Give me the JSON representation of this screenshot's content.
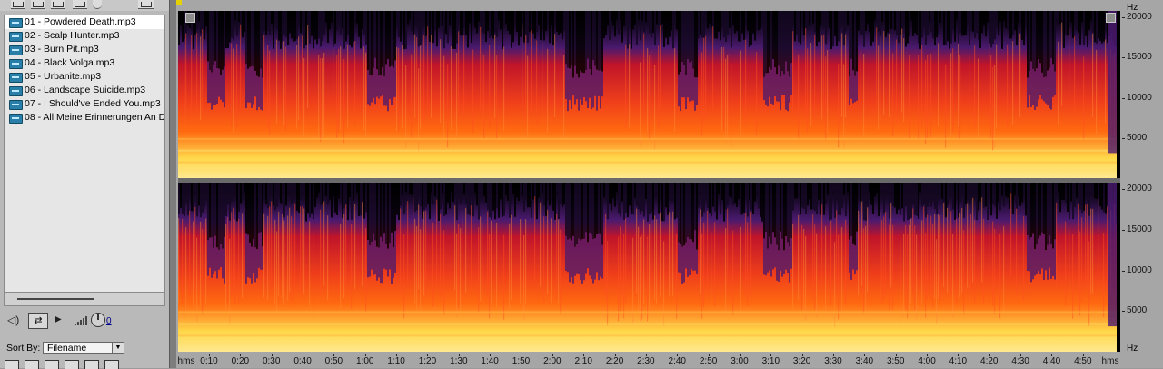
{
  "file_panel": {
    "files": [
      {
        "label": "01 - Powdered Death.mp3",
        "selected": true
      },
      {
        "label": "02 - Scalp Hunter.mp3",
        "selected": false
      },
      {
        "label": "03 - Burn Pit.mp3",
        "selected": false
      },
      {
        "label": "04 - Black Volga.mp3",
        "selected": false
      },
      {
        "label": "05 - Urbanite.mp3",
        "selected": false
      },
      {
        "label": "06 - Landscape Suicide.mp3",
        "selected": false
      },
      {
        "label": "07 - I Should've Ended You.mp3",
        "selected": false
      },
      {
        "label": "08 - All Meine Erinnerungen An D",
        "selected": false
      }
    ],
    "file_icon": "audio-file-icon",
    "toolbar_icons": [
      "open-file-icon",
      "close-file-icon",
      "import-icon",
      "properties-icon",
      "disc-icon",
      "new-window-icon"
    ],
    "transport": {
      "icons": [
        "speaker-icon",
        "loop-icon",
        "play-icon",
        "volume-bars-icon",
        "volume-knob-icon"
      ],
      "volume_value": "0"
    },
    "sort": {
      "label": "Sort By:",
      "value": "Filename"
    }
  },
  "spectral_view": {
    "frequency_axis": {
      "unit": "Hz",
      "labels": [
        "20000",
        "15000",
        "10000",
        "5000"
      ]
    },
    "time_axis": {
      "unit": "hms",
      "labels": [
        "0:10",
        "0:20",
        "0:30",
        "0:40",
        "0:50",
        "1:00",
        "1:10",
        "1:20",
        "1:30",
        "1:40",
        "1:50",
        "2:00",
        "2:10",
        "2:20",
        "2:30",
        "2:40",
        "2:50",
        "3:00",
        "3:10",
        "3:20",
        "3:30",
        "3:40",
        "3:50",
        "4:00",
        "4:10",
        "4:20",
        "4:30",
        "4:40",
        "4:50"
      ],
      "end_unit": "hms"
    },
    "colors": {
      "low_band": "#ffd84a",
      "mid_band": "#ff6a10",
      "high_band": "#c0142a",
      "top_band": "#4a1a6e",
      "background": "#000000"
    }
  }
}
